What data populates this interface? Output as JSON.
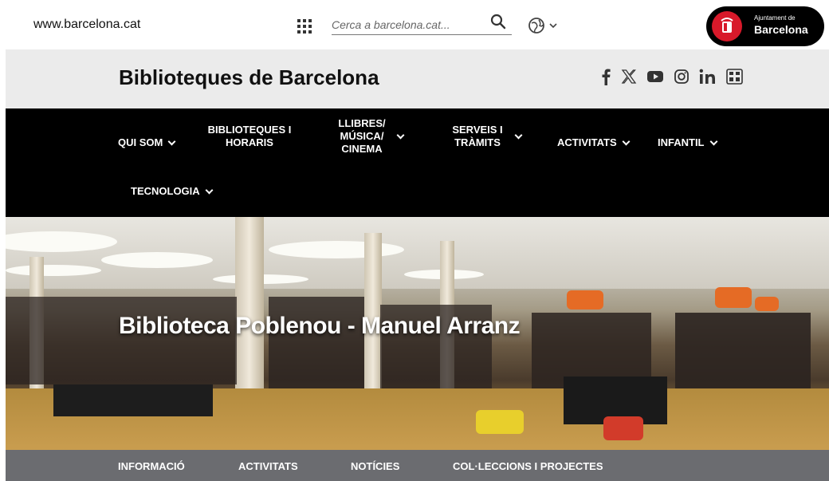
{
  "topbar": {
    "site_url": "www.barcelona.cat",
    "search_placeholder": "Cerca a barcelona.cat...",
    "apps_icon": "grid-icon",
    "search_icon": "magnifier-icon",
    "language_icon": "globe-icon",
    "logo": {
      "small": "Ajuntament de",
      "big": "Barcelona",
      "seal_color": "#d8192a"
    }
  },
  "header": {
    "title": "Biblioteques de Barcelona",
    "socials": [
      "facebook-icon",
      "x-icon",
      "youtube-icon",
      "instagram-icon",
      "linkedin-icon",
      "flickr-icon"
    ]
  },
  "nav": {
    "items": [
      {
        "label": "QUI SOM",
        "dropdown": true
      },
      {
        "label": "BIBLIOTEQUES I HORARIS",
        "dropdown": false
      },
      {
        "label": "LLIBRES/ MÚSICA/ CINEMA",
        "dropdown": true
      },
      {
        "label": "SERVEIS I TRÀMITS",
        "dropdown": true
      },
      {
        "label": "ACTIVITATS",
        "dropdown": true
      },
      {
        "label": "INFANTIL",
        "dropdown": true
      },
      {
        "label": "TECNOLOGIA",
        "dropdown": true
      }
    ]
  },
  "hero": {
    "title": "Biblioteca Poblenou - Manuel Arranz"
  },
  "subnav": {
    "items": [
      "INFORMACIÓ",
      "ACTIVITATS",
      "NOTÍCIES",
      "COL·LECCIONS I PROJECTES"
    ]
  },
  "colors": {
    "nav_bg": "#000000",
    "title_band_bg": "#ebebeb",
    "subnav_bg": "#6b6c70",
    "accent_red": "#d8192a"
  }
}
